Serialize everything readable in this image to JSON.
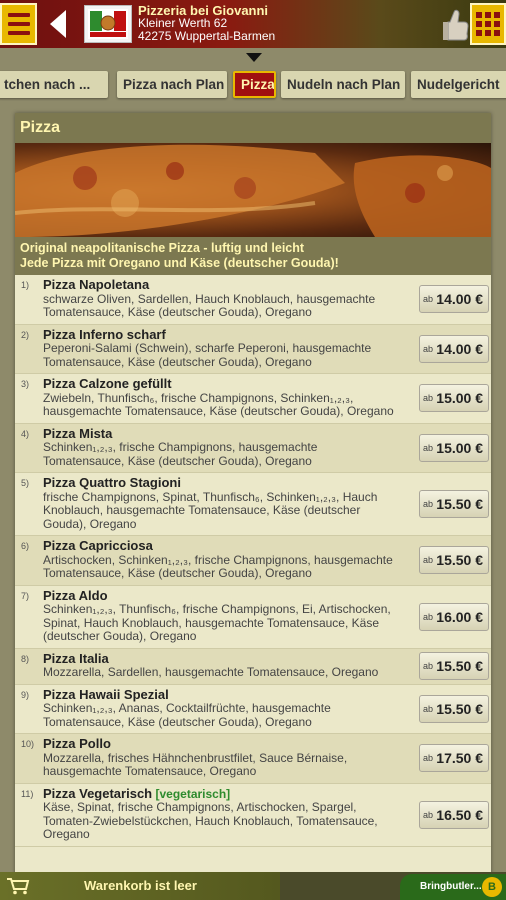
{
  "header": {
    "shop_name": "Pizzeria bei Giovanni",
    "address_line1": "Kleiner Werth 62",
    "address_line2": "42275 Wuppertal-Barmen"
  },
  "tabs": [
    {
      "label": "tchen nach ..."
    },
    {
      "label": "Pizza nach Plan"
    },
    {
      "label": "Pizza",
      "active": true
    },
    {
      "label": "Nudeln nach Plan"
    },
    {
      "label": "Nudelgericht"
    }
  ],
  "category": {
    "title": "Pizza",
    "description_line1": "Original neapolitanische Pizza - luftig und leicht",
    "description_line2": "Jede Pizza mit Oregano und Käse (deutscher Gouda)!"
  },
  "price_prefix": "ab",
  "items": [
    {
      "num": "1)",
      "name": "Pizza Napoletana",
      "desc": "schwarze Oliven, Sardellen, Hauch Knoblauch, hausgemachte Tomatensauce, Käse (deutscher Gouda), Oregano",
      "price": "14.00 €"
    },
    {
      "num": "2)",
      "name": "Pizza Inferno scharf",
      "desc": "Peperoni-Salami (Schwein), scharfe Peperoni, hausgemachte Tomatensauce, Käse (deutscher Gouda), Oregano",
      "price": "14.00 €"
    },
    {
      "num": "3)",
      "name": "Pizza Calzone gefüllt",
      "desc": "Zwiebeln, Thunfisch₆, frische Champignons, Schinken₁,₂,₃, hausgemachte Tomatensauce, Käse (deutscher Gouda), Oregano",
      "price": "15.00 €"
    },
    {
      "num": "4)",
      "name": "Pizza Mista",
      "desc": "Schinken₁,₂,₃, frische Champignons, hausgemachte Tomatensauce, Käse (deutscher Gouda), Oregano",
      "price": "15.00 €"
    },
    {
      "num": "5)",
      "name": "Pizza Quattro Stagioni",
      "desc": "frische Champignons, Spinat, Thunfisch₆, Schinken₁,₂,₃, Hauch Knoblauch, hausgemachte Tomatensauce, Käse (deutscher Gouda), Oregano",
      "price": "15.50 €"
    },
    {
      "num": "6)",
      "name": "Pizza Capricciosa",
      "desc": "Artischocken, Schinken₁,₂,₃, frische Champignons, hausgemachte Tomatensauce, Käse (deutscher Gouda), Oregano",
      "price": "15.50 €"
    },
    {
      "num": "7)",
      "name": "Pizza Aldo",
      "desc": "Schinken₁,₂,₃, Thunfisch₆, frische Champignons, Ei, Artischocken, Spinat, Hauch Knoblauch, hausgemachte Tomatensauce, Käse (deutscher Gouda), Oregano",
      "price": "16.00 €"
    },
    {
      "num": "8)",
      "name": "Pizza Italia",
      "desc": "Mozzarella, Sardellen, hausgemachte Tomatensauce, Oregano",
      "price": "15.50 €"
    },
    {
      "num": "9)",
      "name": "Pizza Hawaii Spezial",
      "desc": "Schinken₁,₂,₃, Ananas, Cocktailfrüchte, hausgemachte Tomatensauce, Käse (deutscher Gouda), Oregano",
      "price": "15.50 €"
    },
    {
      "num": "10)",
      "name": "Pizza Pollo",
      "desc": "Mozzarella, frisches Hähnchenbrustfilet, Sauce Bérnaise, hausgemachte Tomatensauce, Oregano",
      "price": "17.50 €"
    },
    {
      "num": "11)",
      "name": "Pizza Vegetarisch",
      "tag": "[vegetarisch]",
      "desc": "Käse, Spinat, frische Champignons, Artischocken, Spargel, Tomaten-Zwiebelstückchen, Hauch Knoblauch, Tomatensauce, Oregano",
      "price": "16.50 €"
    }
  ],
  "footer": {
    "cart_label": "Warenkorb ist leer",
    "partner_label": "Bringbutler..."
  },
  "colors": {
    "accent_red": "#a01010",
    "accent_yellow": "#e8b800",
    "panel_bg": "#ebe8c9",
    "header_olive": "#7c7850"
  }
}
